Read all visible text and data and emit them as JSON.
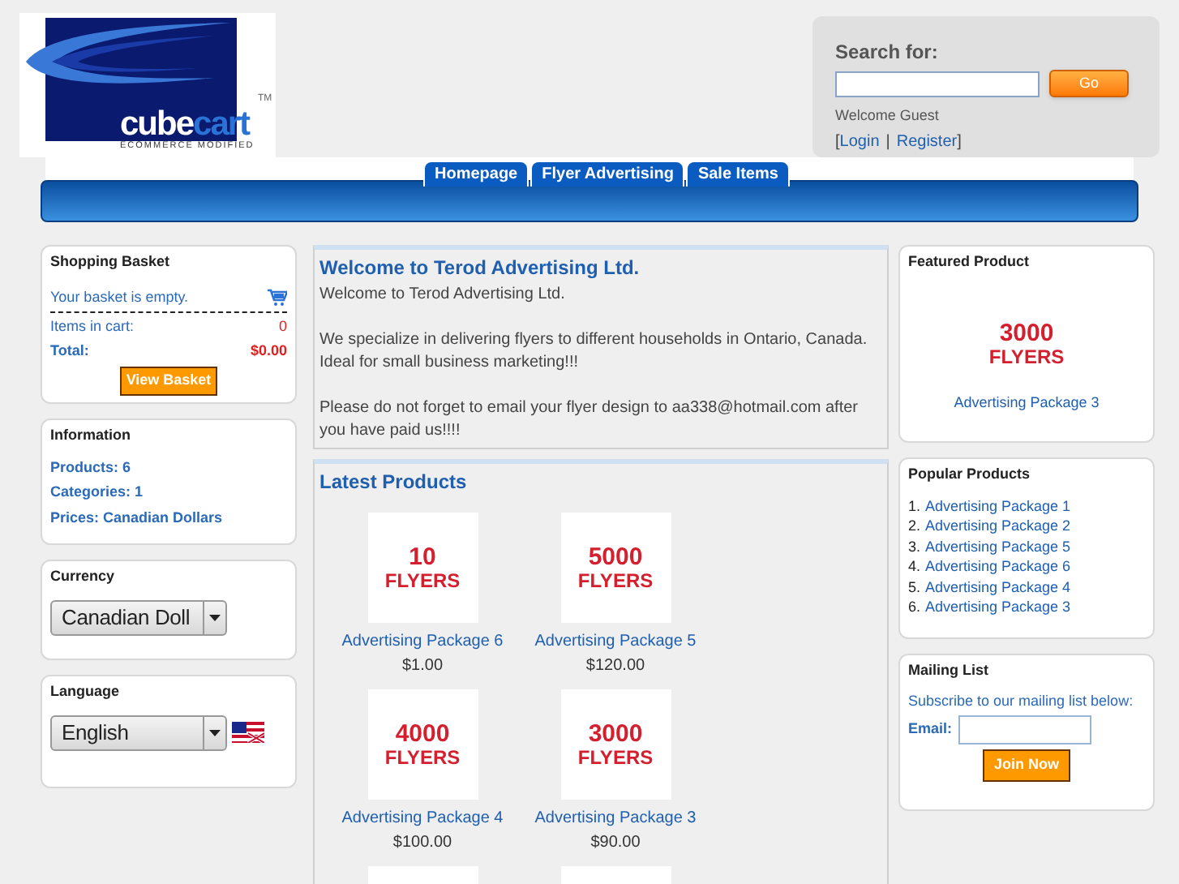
{
  "logo": {
    "word_1": "cube",
    "word_2": "cart",
    "trademark": "TM",
    "tagline": "ECOMMERCE MODIFIED"
  },
  "search": {
    "label": "Search for:",
    "button": "Go",
    "welcome": "Welcome Guest",
    "open_bracket": "[",
    "links": [
      "Login",
      "Register"
    ],
    "separator": "|",
    "close_bracket": "]"
  },
  "nav_tabs": [
    {
      "label": "Homepage"
    },
    {
      "label": "Flyer Advertising"
    },
    {
      "label": "Sale Items"
    }
  ],
  "left": {
    "basket": {
      "title": "Shopping Basket",
      "empty": "Your basket is empty.",
      "items_label": "Items in cart:",
      "items": "0",
      "total_label": "Total:",
      "total": "$0.00",
      "button": "View Basket"
    },
    "information": {
      "title": "Information",
      "lines": [
        "Products: 6",
        "Categories: 1",
        "Prices: Canadian Dollars"
      ]
    },
    "currency": {
      "title": "Currency",
      "value": "Canadian Doll"
    },
    "language": {
      "title": "Language",
      "value": "English"
    }
  },
  "welcome": {
    "title": "Welcome to Terod Advertising Ltd.",
    "paragraphs": [
      "Welcome to Terod Advertising Ltd.",
      "We specialize in delivering flyers to different households in Ontario, Canada. Ideal for small business marketing!!!",
      "Please do not forget to email your flyer design to aa338@hotmail.com after you have paid us!!!!"
    ]
  },
  "latest": {
    "title": "Latest Products",
    "products": [
      {
        "kind": "full",
        "image_lines": [
          "10",
          "FLYERS"
        ],
        "name": "Advertising Package 6",
        "price": "$1.00"
      },
      {
        "kind": "full",
        "image_lines": [
          "5000",
          "FLYERS"
        ],
        "name": "Advertising Package 5",
        "price": "$120.00"
      },
      {
        "kind": "full",
        "image_lines": [
          "4000",
          "FLYERS"
        ],
        "name": "Advertising Package 4",
        "price": "$100.00"
      },
      {
        "kind": "full",
        "image_lines": [
          "3000",
          "FLYERS"
        ],
        "name": "Advertising Package 3",
        "price": "$90.00"
      },
      {
        "kind": "cut"
      },
      {
        "kind": "cut"
      }
    ]
  },
  "right": {
    "featured": {
      "title": "Featured Product",
      "image_lines": [
        "3000",
        "FLYERS"
      ],
      "name": "Advertising Package 3"
    },
    "popular": {
      "title": "Popular Products",
      "items": [
        {
          "number": "1.",
          "name": "Advertising Package 1"
        },
        {
          "number": "2.",
          "name": "Advertising Package 2"
        },
        {
          "number": "3.",
          "name": "Advertising Package 5"
        },
        {
          "number": "4.",
          "name": "Advertising Package 6"
        },
        {
          "number": "5.",
          "name": "Advertising Package 4"
        },
        {
          "number": "6.",
          "name": "Advertising Package 3"
        }
      ]
    },
    "mailing": {
      "title": "Mailing List",
      "text": "Subscribe to our mailing list below:",
      "email_label": "Email:",
      "button": "Join Now"
    }
  }
}
